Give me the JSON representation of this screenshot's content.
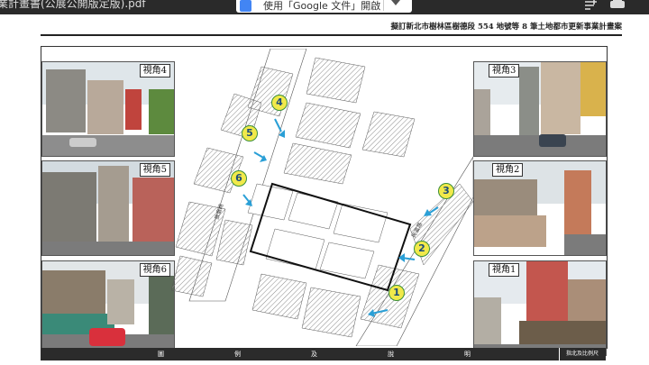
{
  "viewer": {
    "file_title": "業計畫書(公展公開版定版).pdf",
    "open_with_label": "使用「Google 文件」開啟",
    "icons": [
      "google-docs-icon",
      "chevron-down-icon",
      "add-to-drive-icon",
      "print-icon"
    ]
  },
  "document": {
    "title": "擬訂新北市樹林區樹德段 554 地號等 8 筆土地都市更新事業計畫案",
    "photos": [
      {
        "label": "視角4"
      },
      {
        "label": "視角5"
      },
      {
        "label": "視角6"
      },
      {
        "label": "視角3"
      },
      {
        "label": "視角2"
      },
      {
        "label": "視角1"
      }
    ],
    "markers": [
      "1",
      "2",
      "3",
      "4",
      "5",
      "6"
    ],
    "legend_cells": [
      "圖",
      "例",
      "及",
      "說",
      "明"
    ],
    "legend_right": "指北及比例尺"
  },
  "colors": {
    "marker_fill": "#f1e94a",
    "marker_border": "#3a8f3a",
    "arrow": "#2a9fd6",
    "brand": "#4285f4"
  }
}
